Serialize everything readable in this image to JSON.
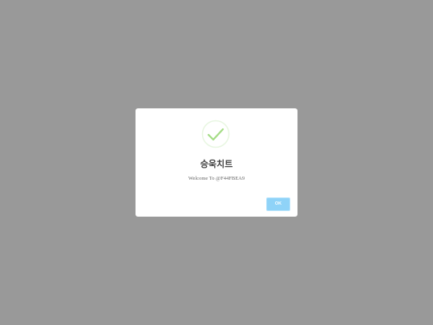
{
  "dialog": {
    "icon": "success-checkmark-icon",
    "title": "승욱치트",
    "message": "Welcome To @F44FBEA9",
    "ok_label": "OK"
  },
  "colors": {
    "overlay": "#999999",
    "dialog_background": "#ffffff",
    "check_stroke": "#a5dc86",
    "check_ring": "rgba(165,220,134,0.2)",
    "button_background": "#8fd3f8"
  }
}
